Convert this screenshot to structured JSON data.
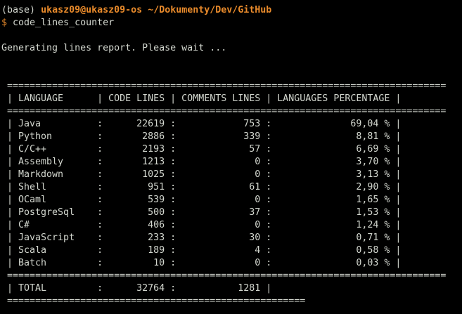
{
  "prompt": {
    "env": "(base)",
    "user_host": "ukasz09@ukasz09-os",
    "cwd": "~/Dokumenty/Dev/GitHub",
    "symbol": "$",
    "command": "code_lines_counter"
  },
  "output": {
    "status": "Generating lines report. Please wait ...",
    "separator": " ==============================================================================",
    "total_separator": " =====================================================",
    "header": " | LANGUAGE      | CODE LINES | COMMENTS LINES | LANGUAGES PERCENTAGE |",
    "rows": [
      " | Java          :      22619 :            753 :              69,04 % |",
      " | Python        :       2886 :            339 :               8,81 % |",
      " | C/C++         :       2193 :             57 :               6,69 % |",
      " | Assembly      :       1213 :              0 :               3,70 % |",
      " | Markdown      :       1025 :              0 :               3,13 % |",
      " | Shell         :        951 :             61 :               2,90 % |",
      " | OCaml         :        539 :              0 :               1,65 % |",
      " | PostgreSql    :        500 :             37 :               1,53 % |",
      " | C#            :        406 :              0 :               1,24 % |",
      " | JavaScript    :        233 :             30 :               0,71 % |",
      " | Scala         :        189 :              4 :               0,58 % |",
      " | Batch         :         10 :              0 :               0,03 % |"
    ],
    "total_row": " | TOTAL         :      32764 :           1281 |"
  }
}
